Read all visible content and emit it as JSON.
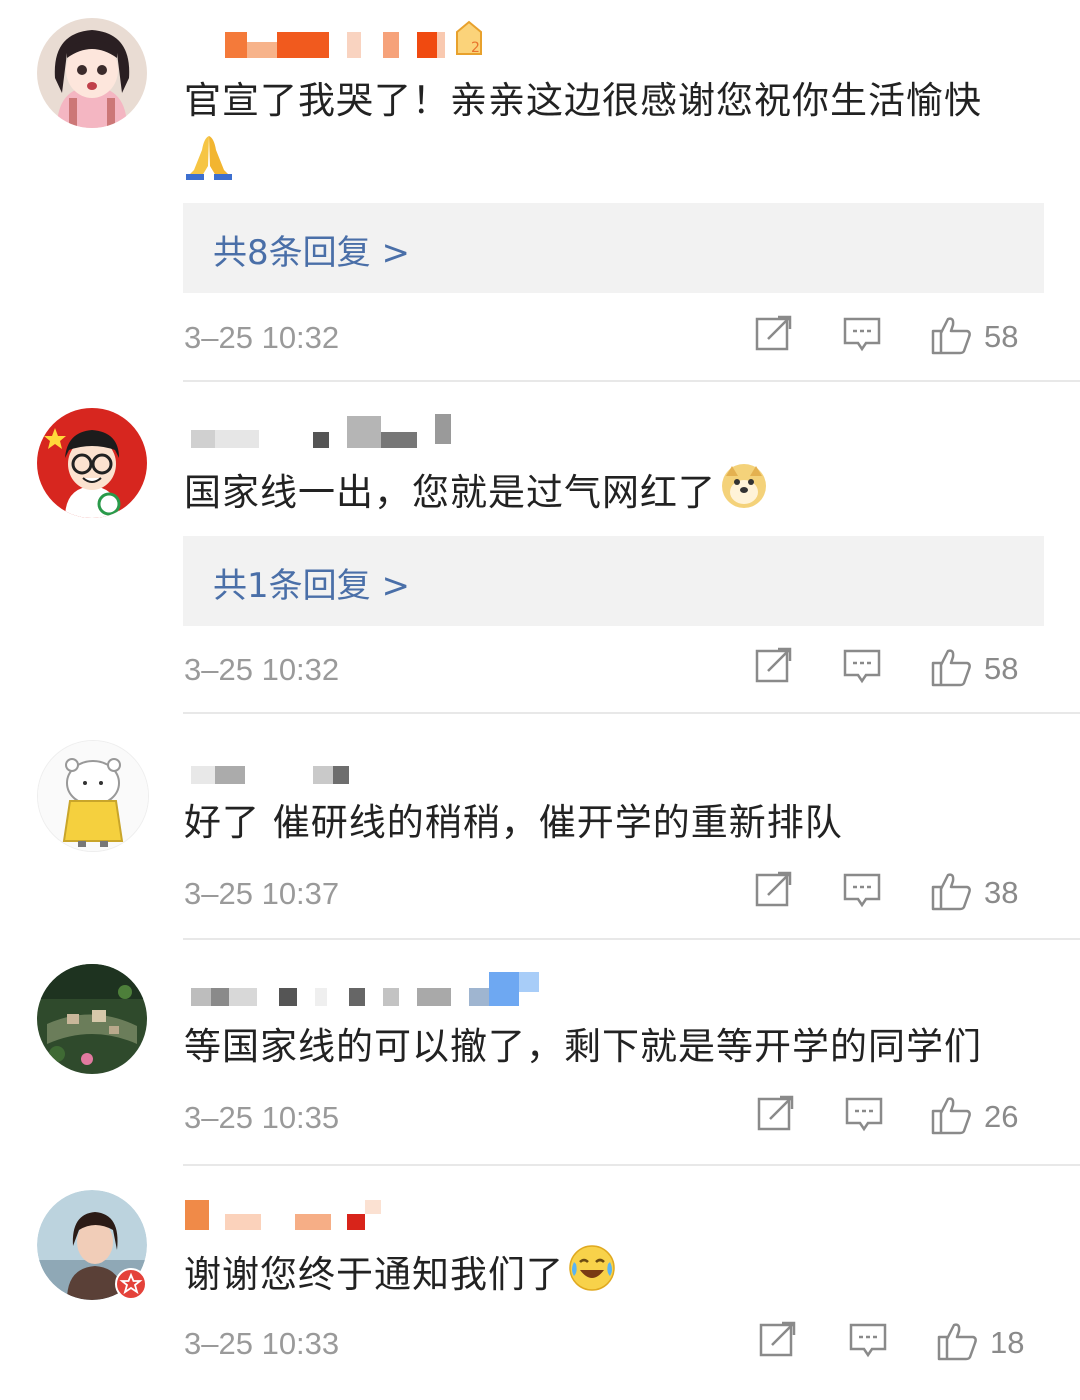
{
  "comments": [
    {
      "text": "官宣了我哭了！亲亲这边很感谢您祝你生活愉快",
      "emoji": "🙏",
      "reply_label": "共8条回复 >",
      "time": "3–25 10:32",
      "likes": "58",
      "avatar_icon": "girl-cartoon-avatar"
    },
    {
      "text": "国家线一出，您就是过气网红了",
      "emoji": "doge",
      "reply_label": "共1条回复 >",
      "time": "3–25 10:32",
      "likes": "58",
      "avatar_icon": "glasses-boy-avatar"
    },
    {
      "text": "好了 催研线的稍稍，催开学的重新排队",
      "time": "3–25 10:37",
      "likes": "38",
      "avatar_icon": "bear-raincoat-avatar"
    },
    {
      "text": "等国家线的可以撤了，剩下就是等开学的同学们",
      "time": "3–25 10:35",
      "likes": "26",
      "avatar_icon": "aerial-town-avatar"
    },
    {
      "text": "谢谢您终于通知我们了",
      "emoji": "laugh-cry",
      "time": "3–25 10:33",
      "likes": "18",
      "avatar_icon": "woman-photo-avatar"
    }
  ],
  "colors": {
    "reply_link": "#4a6fa8",
    "meta_gray": "#9a9a9a",
    "reply_bg": "#f2f2f2"
  }
}
